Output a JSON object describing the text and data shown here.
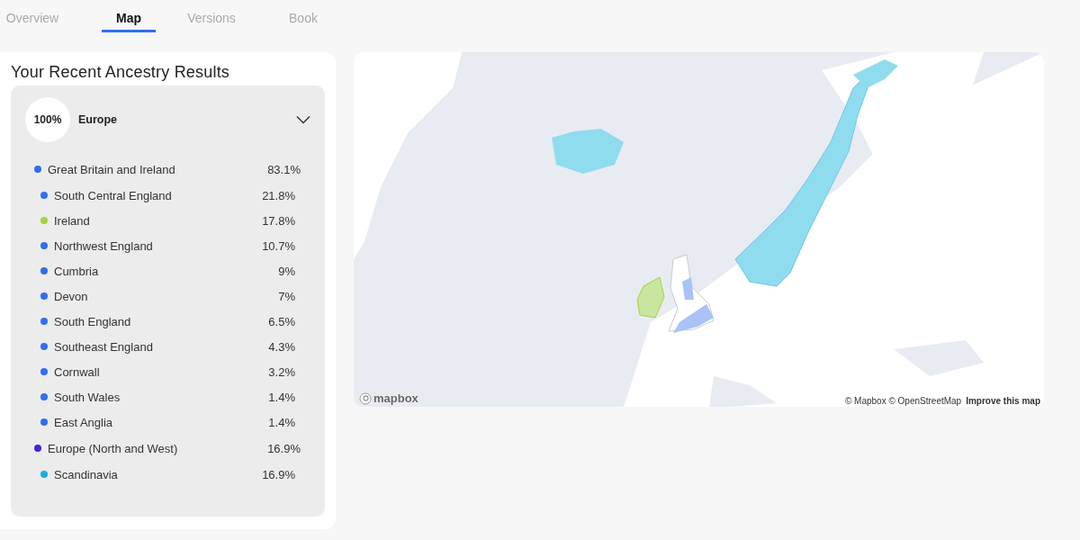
{
  "tabs": [
    {
      "label": "Overview",
      "selected": false
    },
    {
      "label": "Map",
      "selected": true
    },
    {
      "label": "Versions",
      "selected": false
    },
    {
      "label": "Book",
      "selected": false
    }
  ],
  "results": {
    "title": "Your Recent Ancestry Results",
    "region": {
      "percent": "100%",
      "name": "Europe",
      "expanded": true,
      "groups": [
        {
          "name": "Great Britain and Ireland",
          "percent": "83.1%",
          "color": "#2f6ff0",
          "children": [
            {
              "name": "South Central England",
              "percent": "21.8%",
              "color": "#2f6ff0"
            },
            {
              "name": "Ireland",
              "percent": "17.8%",
              "color": "#a6d33a"
            },
            {
              "name": "Northwest England",
              "percent": "10.7%",
              "color": "#2f6ff0"
            },
            {
              "name": "Cumbria",
              "percent": "9%",
              "color": "#2f6ff0"
            },
            {
              "name": "Devon",
              "percent": "7%",
              "color": "#2f6ff0"
            },
            {
              "name": "South England",
              "percent": "6.5%",
              "color": "#2f6ff0"
            },
            {
              "name": "Southeast England",
              "percent": "4.3%",
              "color": "#2f6ff0"
            },
            {
              "name": "Cornwall",
              "percent": "3.2%",
              "color": "#2f6ff0"
            },
            {
              "name": "South Wales",
              "percent": "1.4%",
              "color": "#2f6ff0"
            },
            {
              "name": "East Anglia",
              "percent": "1.4%",
              "color": "#2f6ff0"
            }
          ]
        },
        {
          "name": "Europe (North and West)",
          "percent": "16.9%",
          "color": "#4a1fd8",
          "children": [
            {
              "name": "Scandinavia",
              "percent": "16.9%",
              "color": "#1ab0e0"
            }
          ]
        }
      ]
    }
  },
  "map": {
    "kind": "picture",
    "logo": "mapbox",
    "attribution": "© Mapbox © OpenStreetMap",
    "improve_link": "Improve this map"
  }
}
